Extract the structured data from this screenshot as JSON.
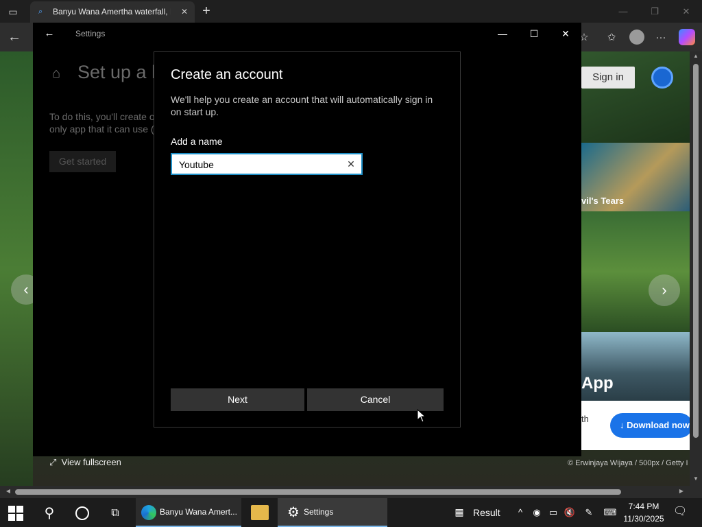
{
  "browser": {
    "tab_title": "Banyu Wana Amertha waterfall, B",
    "tab_close": "✕",
    "new_tab": "+",
    "toolbar_icons": [
      "back-icon",
      "favorites-icon",
      "profile-icon",
      "more-icon",
      "copilot-icon"
    ],
    "more_label": "···"
  },
  "page": {
    "sign_in": "Sign in",
    "carousel_caption": "vil's Tears",
    "promo_title": "App",
    "promo_fragment": "th",
    "download_button": "↓ Download now",
    "view_fullscreen": "View fullscreen",
    "photo_credit": "© Erwinjaya Wijaya / 500px / Getty I"
  },
  "settings_window": {
    "title": "Settings",
    "heading": "Set up a k",
    "description_line1": "To do this, you'll create o",
    "description_line2": "only app that it can use (",
    "get_started": "Get started"
  },
  "dialog": {
    "title": "Create an account",
    "description": "We'll help you create an account that will automatically sign in on start up.",
    "name_label": "Add a name",
    "name_value": "Youtube",
    "next_button": "Next",
    "cancel_button": "Cancel"
  },
  "taskbar": {
    "edge_label": "Banyu Wana Amert...",
    "settings_label": "Settings",
    "result_label": "Result",
    "time": "7:44 PM",
    "date": "11/30/2025"
  },
  "colors": {
    "accent": "#1e90c8",
    "download_blue": "#1a73e8",
    "taskbar_highlight": "#7ab6e8"
  }
}
